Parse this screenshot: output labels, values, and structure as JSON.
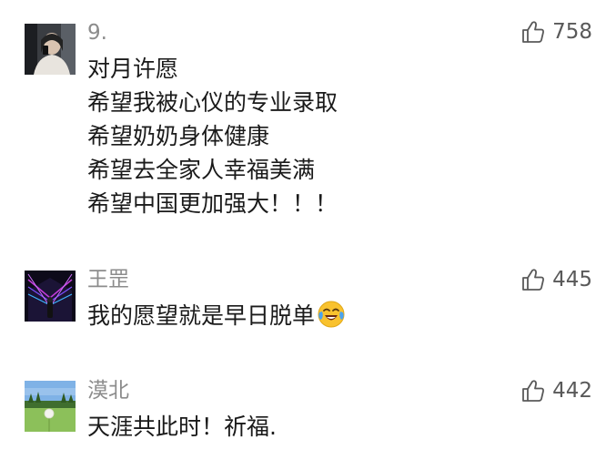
{
  "comments": [
    {
      "author": "9.",
      "likes": "758",
      "lines": [
        "对月许愿",
        "希望我被心仪的专业录取",
        "希望奶奶身体健康",
        "希望去全家人幸福美满",
        "希望中国更加强大！！！"
      ],
      "avatar_icon": "person-selfie-avatar"
    },
    {
      "author": "王罡",
      "likes": "445",
      "lines": [
        "我的愿望就是早日脱单"
      ],
      "emoji_icon": "face-with-tears-of-joy-icon",
      "avatar_icon": "neon-tunnel-avatar"
    },
    {
      "author": "漠北",
      "likes": "442",
      "lines": [
        "天涯共此时！祈福."
      ],
      "avatar_icon": "dandelion-field-avatar"
    }
  ],
  "colors": {
    "name": "#8c8c8c",
    "text": "#1a1a1a",
    "like_icon": "#595959"
  }
}
